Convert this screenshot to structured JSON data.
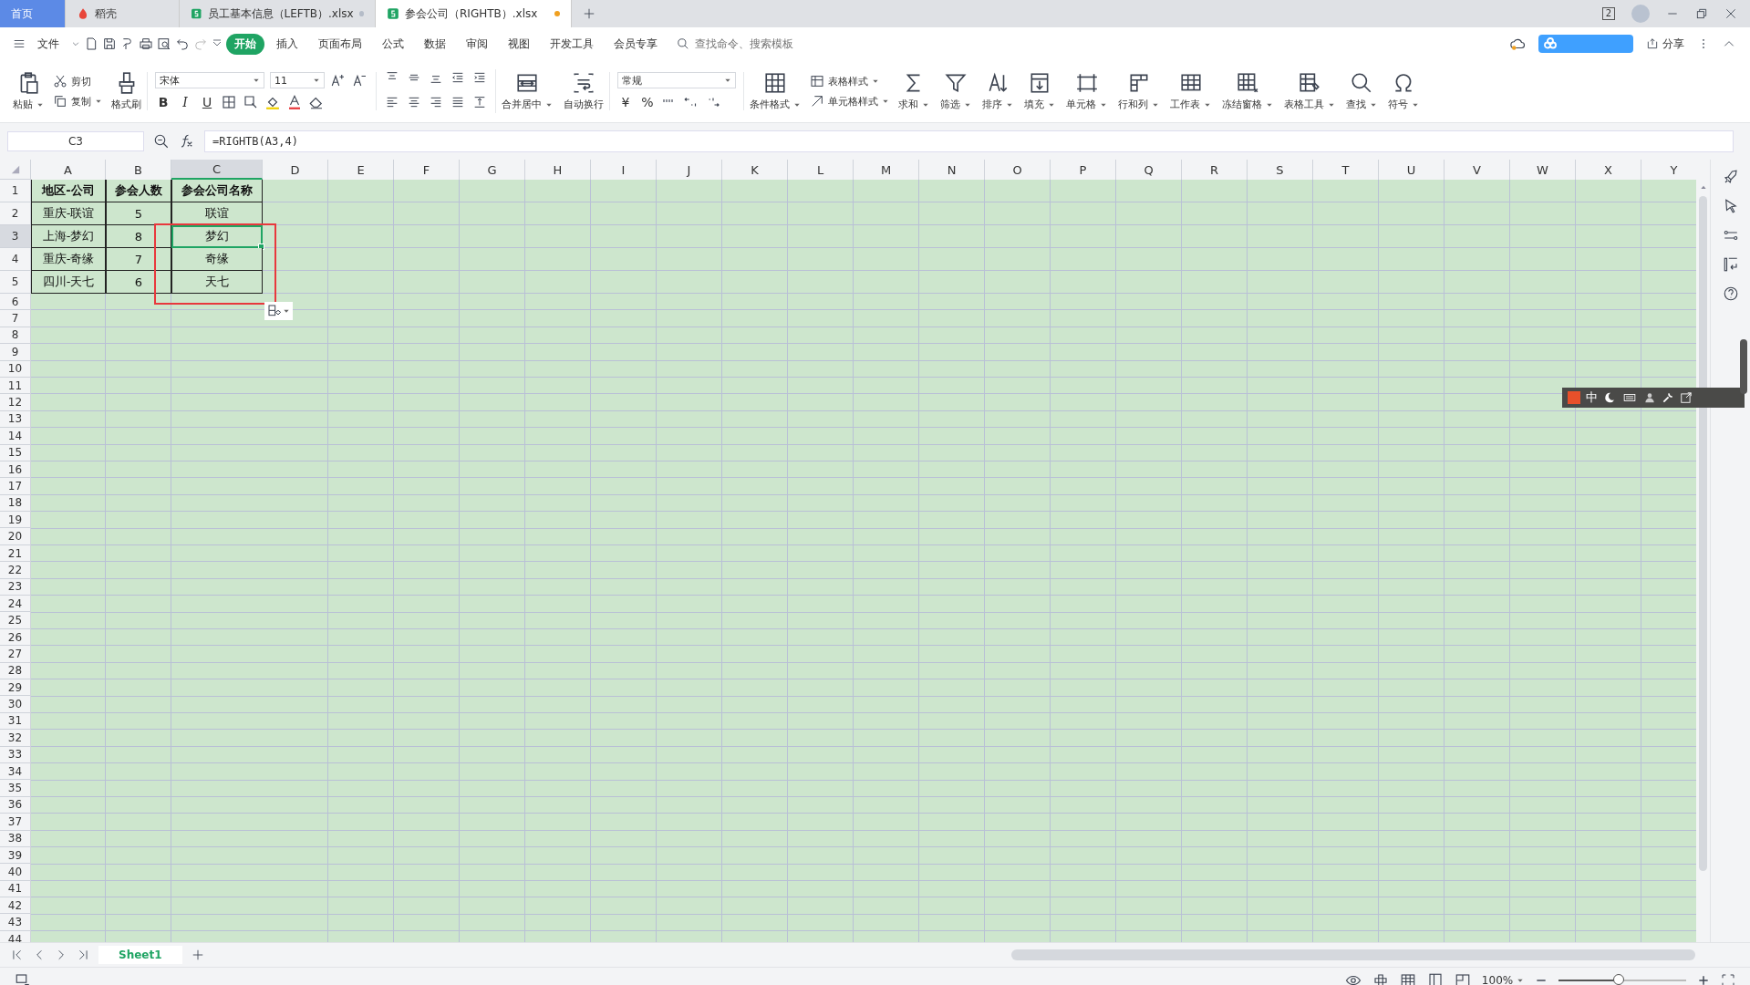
{
  "tabs": [
    {
      "label": "首页",
      "kind": "home",
      "selected": false
    },
    {
      "label": "稻壳",
      "kind": "docer",
      "selected": false
    },
    {
      "label": "员工基本信息（LEFTB）.xlsx",
      "kind": "sheet",
      "selected": false,
      "modified": false
    },
    {
      "label": "参会公司（RIGHTB）.xlsx",
      "kind": "sheet",
      "selected": true,
      "modified": true
    }
  ],
  "window_count": "2",
  "menu": [
    {
      "label": "文件",
      "selected": false
    },
    {
      "label": "开始",
      "selected": true
    },
    {
      "label": "插入",
      "selected": false
    },
    {
      "label": "页面布局",
      "selected": false
    },
    {
      "label": "公式",
      "selected": false
    },
    {
      "label": "数据",
      "selected": false
    },
    {
      "label": "审阅",
      "selected": false
    },
    {
      "label": "视图",
      "selected": false
    },
    {
      "label": "开发工具",
      "selected": false
    },
    {
      "label": "会员专享",
      "selected": false
    }
  ],
  "search": {
    "placeholder": "查找命令、搜索模板"
  },
  "share": "分享",
  "ribbon": [
    {
      "kind": "large",
      "label": "粘贴",
      "dropdown": true
    },
    {
      "kind": "stack",
      "items": [
        {
          "label": "剪切",
          "dropdown": false
        },
        {
          "label": "复制",
          "dropdown": true
        }
      ]
    },
    {
      "kind": "large",
      "label": "格式刷",
      "dropdown": false
    },
    {
      "kind": "font",
      "font": "宋体",
      "size": "11",
      "styles": [
        "B",
        "I",
        "U"
      ]
    },
    {
      "kind": "align"
    },
    {
      "kind": "large",
      "label": "合并居中",
      "dropdown": true
    },
    {
      "kind": "large",
      "label": "自动换行",
      "dropdown": false
    },
    {
      "kind": "number",
      "format": "常规",
      "symbols": [
        "¥",
        "%"
      ]
    },
    {
      "kind": "large",
      "label": "条件格式",
      "dropdown": true
    },
    {
      "kind": "stack",
      "items": [
        {
          "label": "表格样式",
          "dropdown": true
        },
        {
          "label": "单元格样式",
          "dropdown": true
        }
      ]
    },
    {
      "kind": "large",
      "label": "求和",
      "dropdown": true
    },
    {
      "kind": "large",
      "label": "筛选",
      "dropdown": true
    },
    {
      "kind": "large",
      "label": "排序",
      "dropdown": true
    },
    {
      "kind": "large",
      "label": "填充",
      "dropdown": true
    },
    {
      "kind": "large",
      "label": "单元格",
      "dropdown": true
    },
    {
      "kind": "large",
      "label": "行和列",
      "dropdown": true
    },
    {
      "kind": "large",
      "label": "工作表",
      "dropdown": true
    },
    {
      "kind": "large",
      "label": "冻结窗格",
      "dropdown": true
    },
    {
      "kind": "large",
      "label": "表格工具",
      "dropdown": true
    },
    {
      "kind": "large",
      "label": "查找",
      "dropdown": true
    },
    {
      "kind": "large",
      "label": "符号",
      "dropdown": true
    }
  ],
  "name_box": "C3",
  "formula": "=RIGHTB(A3,4)",
  "columns": [
    {
      "letter": "A",
      "selected": false
    },
    {
      "letter": "B",
      "selected": false
    },
    {
      "letter": "C",
      "selected": true
    },
    {
      "letter": "D",
      "selected": false
    },
    {
      "letter": "E",
      "selected": false
    },
    {
      "letter": "F",
      "selected": false
    },
    {
      "letter": "G",
      "selected": false
    },
    {
      "letter": "H",
      "selected": false
    },
    {
      "letter": "I",
      "selected": false
    },
    {
      "letter": "J",
      "selected": false
    },
    {
      "letter": "K",
      "selected": false
    },
    {
      "letter": "L",
      "selected": false
    },
    {
      "letter": "M",
      "selected": false
    },
    {
      "letter": "N",
      "selected": false
    },
    {
      "letter": "O",
      "selected": false
    },
    {
      "letter": "P",
      "selected": false
    },
    {
      "letter": "Q",
      "selected": false
    },
    {
      "letter": "R",
      "selected": false
    },
    {
      "letter": "S",
      "selected": false
    },
    {
      "letter": "T",
      "selected": false
    },
    {
      "letter": "U",
      "selected": false
    },
    {
      "letter": "V",
      "selected": false
    },
    {
      "letter": "W",
      "selected": false
    },
    {
      "letter": "X",
      "selected": false
    },
    {
      "letter": "Y",
      "selected": false
    }
  ],
  "rows": [
    {
      "number": "1",
      "kind": "header",
      "selected": false,
      "cells": [
        {
          "text": "地区-公司",
          "selected": false
        },
        {
          "text": "参会人数",
          "selected": false
        },
        {
          "text": "参会公司名称",
          "selected": false
        }
      ]
    },
    {
      "number": "2",
      "kind": "data",
      "selected": false,
      "cells": [
        {
          "text": "重庆-联谊",
          "selected": false
        },
        {
          "text": "5",
          "selected": false
        },
        {
          "text": "联谊",
          "selected": false
        }
      ]
    },
    {
      "number": "3",
      "kind": "data",
      "selected": true,
      "cells": [
        {
          "text": "上海-梦幻",
          "selected": false
        },
        {
          "text": "8",
          "selected": false
        },
        {
          "text": "梦幻",
          "selected": true
        }
      ]
    },
    {
      "number": "4",
      "kind": "data",
      "selected": false,
      "cells": [
        {
          "text": "重庆-奇缘",
          "selected": false
        },
        {
          "text": "7",
          "selected": false
        },
        {
          "text": "奇缘",
          "selected": false
        }
      ]
    },
    {
      "number": "5",
      "kind": "data",
      "selected": false,
      "cells": [
        {
          "text": "四川-天七",
          "selected": false
        },
        {
          "text": "6",
          "selected": false
        },
        {
          "text": "天七",
          "selected": false
        }
      ]
    },
    {
      "number": "6",
      "kind": "empty",
      "selected": false
    },
    {
      "number": "7",
      "kind": "empty",
      "selected": false
    },
    {
      "number": "8",
      "kind": "empty",
      "selected": false
    },
    {
      "number": "9",
      "kind": "empty",
      "selected": false
    },
    {
      "number": "10",
      "kind": "empty",
      "selected": false
    },
    {
      "number": "11",
      "kind": "empty",
      "selected": false
    },
    {
      "number": "12",
      "kind": "empty",
      "selected": false
    },
    {
      "number": "13",
      "kind": "empty",
      "selected": false
    },
    {
      "number": "14",
      "kind": "empty",
      "selected": false
    },
    {
      "number": "15",
      "kind": "empty",
      "selected": false
    },
    {
      "number": "16",
      "kind": "empty",
      "selected": false
    },
    {
      "number": "17",
      "kind": "empty",
      "selected": false
    },
    {
      "number": "18",
      "kind": "empty",
      "selected": false
    },
    {
      "number": "19",
      "kind": "empty",
      "selected": false
    },
    {
      "number": "20",
      "kind": "empty",
      "selected": false
    },
    {
      "number": "21",
      "kind": "empty",
      "selected": false
    },
    {
      "number": "22",
      "kind": "empty",
      "selected": false
    },
    {
      "number": "23",
      "kind": "empty",
      "selected": false
    },
    {
      "number": "24",
      "kind": "empty",
      "selected": false
    },
    {
      "number": "25",
      "kind": "empty",
      "selected": false
    },
    {
      "number": "26",
      "kind": "empty",
      "selected": false
    },
    {
      "number": "27",
      "kind": "empty",
      "selected": false
    },
    {
      "number": "28",
      "kind": "empty",
      "selected": false
    },
    {
      "number": "29",
      "kind": "empty",
      "selected": false
    },
    {
      "number": "30",
      "kind": "empty",
      "selected": false
    },
    {
      "number": "31",
      "kind": "empty",
      "selected": false
    },
    {
      "number": "32",
      "kind": "empty",
      "selected": false
    },
    {
      "number": "33",
      "kind": "empty",
      "selected": false
    },
    {
      "number": "34",
      "kind": "empty",
      "selected": false
    },
    {
      "number": "35",
      "kind": "empty",
      "selected": false
    },
    {
      "number": "36",
      "kind": "empty",
      "selected": false
    },
    {
      "number": "37",
      "kind": "empty",
      "selected": false
    },
    {
      "number": "38",
      "kind": "empty",
      "selected": false
    },
    {
      "number": "39",
      "kind": "empty",
      "selected": false
    },
    {
      "number": "40",
      "kind": "empty",
      "selected": false
    },
    {
      "number": "41",
      "kind": "empty",
      "selected": false
    },
    {
      "number": "42",
      "kind": "empty",
      "selected": false
    },
    {
      "number": "43",
      "kind": "empty",
      "selected": false
    },
    {
      "number": "44",
      "kind": "empty",
      "selected": false
    }
  ],
  "sheets": [
    {
      "label": "Sheet1",
      "selected": true
    }
  ],
  "ime": {
    "mode": "中"
  },
  "zoom": {
    "label": "100%",
    "level": 0.48
  }
}
